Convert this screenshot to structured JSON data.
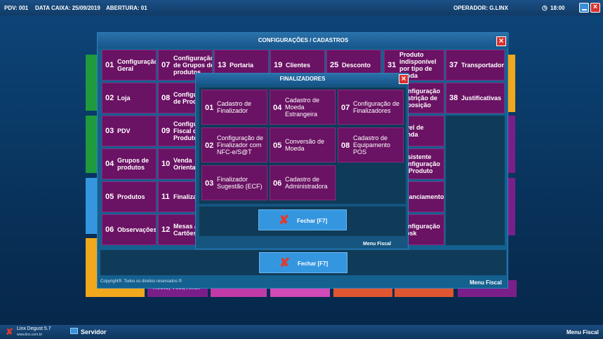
{
  "topbar": {
    "pdv": "PDV: 001",
    "data_caixa": "DATA CAIXA: 25/09/2019",
    "abertura": "ABERTURA: 01",
    "operador": "OPERADOR: G.LINX",
    "clock_icon": "clock-icon",
    "time": "18:00",
    "minimize_icon": "minimize-icon",
    "close_icon": "close-icon"
  },
  "background_tiles": {
    "labels": [
      "Resto, Vest, Anex",
      "Menu Fiscal"
    ]
  },
  "main_dialog": {
    "title": "CONFIGURAÇÕES / CADASTROS",
    "close_icon": "close-icon",
    "items": [
      {
        "num": "01",
        "label": "Configuração Geral"
      },
      {
        "num": "07",
        "label": "Configuração de Grupos de produtos"
      },
      {
        "num": "13",
        "label": "Portaria"
      },
      {
        "num": "19",
        "label": "Clientes"
      },
      {
        "num": "25",
        "label": "Desconto"
      },
      {
        "num": "31",
        "label": "Produto indisponível por tipo de venda"
      },
      {
        "num": "37",
        "label": "Transportador"
      },
      {
        "num": "02",
        "label": "Loja"
      },
      {
        "num": "08",
        "label": "Configuração de Produtos"
      },
      {
        "num": "32",
        "label": "Configuração Restrição de Exposição"
      },
      {
        "num": "38",
        "label": "Justificativas"
      },
      {
        "num": "03",
        "label": "PDV"
      },
      {
        "num": "09",
        "label": "Configuração Fiscal de Produtos"
      },
      {
        "num": "33",
        "label": "Nível de Venda"
      },
      {
        "num": "04",
        "label": "Grupos de produtos"
      },
      {
        "num": "10",
        "label": "Venda Orientada"
      },
      {
        "num": "34",
        "label": "Assistente Configuração de Produto"
      },
      {
        "num": "05",
        "label": "Produtos"
      },
      {
        "num": "11",
        "label": "Finalizadores"
      },
      {
        "num": "35",
        "label": "Financiamento"
      },
      {
        "num": "06",
        "label": "Observações"
      },
      {
        "num": "12",
        "label": "Mesas / Cartões"
      },
      {
        "num": "36",
        "label": "Configuração Kiosk"
      }
    ],
    "fechar_label": "Fechar [F7]",
    "fechar_icon": "x-mark-icon",
    "copyright": "Copyright®. Todos os direitos reservados ®",
    "menu_fiscal": "Menu Fiscal"
  },
  "finalizadores_dialog": {
    "title": "FINALIZADORES",
    "close_icon": "close-icon",
    "items": [
      {
        "num": "01",
        "label": "Cadastro de Finalizador"
      },
      {
        "num": "04",
        "label": "Cadastro de Moeda Estrangeira"
      },
      {
        "num": "07",
        "label": "Configuração de Finalizadores"
      },
      {
        "num": "02",
        "label": "Configuração de Finalizador com NFC-e/S@T"
      },
      {
        "num": "05",
        "label": "Conversão de Moeda"
      },
      {
        "num": "08",
        "label": "Cadastro de Equipamento POS"
      },
      {
        "num": "03",
        "label": "Finalizador Sugestão (ECF)"
      },
      {
        "num": "06",
        "label": "Cadastro de Administradora"
      }
    ],
    "fechar_label": "Fechar [F7]",
    "fechar_icon": "x-mark-icon",
    "menu_fiscal": "Menu Fiscal"
  },
  "taskbar": {
    "app_icon": "linx-logo-icon",
    "app_name": "Linx Degust 5.7",
    "site": "www.linx.com.br",
    "server_icon": "monitor-icon",
    "server": "Servidor",
    "menu_fiscal": "Menu Fiscal"
  },
  "colors": {
    "tile_purple": "#6a1263",
    "accent_blue": "#3596e0",
    "close_red": "#d8302e"
  }
}
